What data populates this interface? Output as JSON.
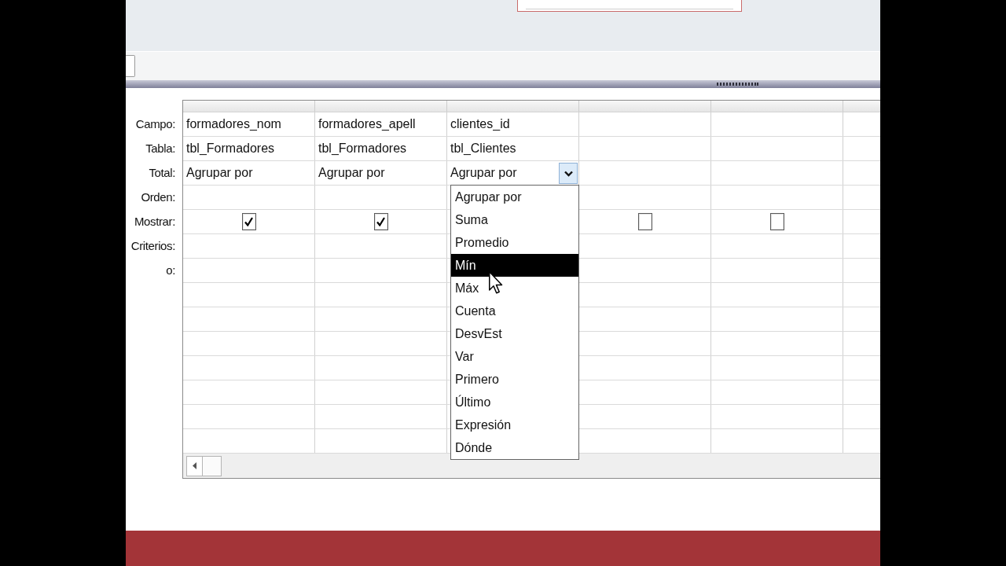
{
  "query_grid": {
    "row_labels": [
      "Campo:",
      "Tabla:",
      "Total:",
      "Orden:",
      "Mostrar:",
      "Criterios:",
      "o:"
    ],
    "columns": [
      {
        "field": "formadores_nom",
        "table": "tbl_Formadores",
        "total": "Agrupar por",
        "show": true
      },
      {
        "field": "formadores_apell",
        "table": "tbl_Formadores",
        "total": "Agrupar por",
        "show": true
      },
      {
        "field": "clientes_id",
        "table": "tbl_Clientes",
        "total": "Agrupar por",
        "total_menu": {
          "expanded": true,
          "options": [
            {
              "label": "Agrupar por",
              "selected": false
            },
            {
              "label": "Suma",
              "selected": false
            },
            {
              "label": "Promedio",
              "selected": false
            },
            {
              "label": "Mín",
              "selected": true
            },
            {
              "label": "Máx",
              "selected": false
            },
            {
              "label": "Cuenta",
              "selected": false
            },
            {
              "label": "DesvEst",
              "selected": false
            },
            {
              "label": "Var",
              "selected": false
            },
            {
              "label": "Primero",
              "selected": false
            },
            {
              "label": "Último",
              "selected": false
            },
            {
              "label": "Expresión",
              "selected": false
            },
            {
              "label": "Dónde",
              "selected": false
            }
          ]
        }
      },
      {
        "show": false
      },
      {
        "show": false
      }
    ]
  }
}
